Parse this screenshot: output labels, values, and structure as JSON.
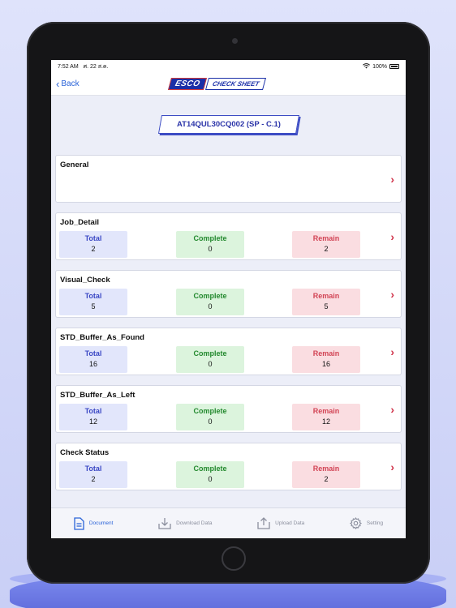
{
  "status": {
    "time": "7:52 AM",
    "date": "ศ. 22 ส.ค.",
    "battery": "100%"
  },
  "nav": {
    "back_label": "Back",
    "logo_brand": "ESCO",
    "logo_title": "CHECK SHEET"
  },
  "doc_id": "AT14QUL30CQ002 (SP - C.1)",
  "general": {
    "title": "General"
  },
  "labels": {
    "total": "Total",
    "complete": "Complete",
    "remain": "Remain"
  },
  "sections": [
    {
      "title": "Job_Detail",
      "total": "2",
      "complete": "0",
      "remain": "2"
    },
    {
      "title": "Visual_Check",
      "total": "5",
      "complete": "0",
      "remain": "5"
    },
    {
      "title": "STD_Buffer_As_Found",
      "total": "16",
      "complete": "0",
      "remain": "16"
    },
    {
      "title": "STD_Buffer_As_Left",
      "total": "12",
      "complete": "0",
      "remain": "12"
    },
    {
      "title": "Check Status",
      "total": "2",
      "complete": "0",
      "remain": "2"
    }
  ],
  "tabs": [
    {
      "label": "Document",
      "icon": "document-icon"
    },
    {
      "label": "Download Data",
      "icon": "download-icon"
    },
    {
      "label": "Upload Data",
      "icon": "upload-icon"
    },
    {
      "label": "Setting",
      "icon": "gear-icon"
    }
  ],
  "colors": {
    "accent": "#2a63d8",
    "total": "#3b48c4",
    "complete": "#23892e",
    "remain": "#d24455",
    "arrow": "#d0334a"
  }
}
